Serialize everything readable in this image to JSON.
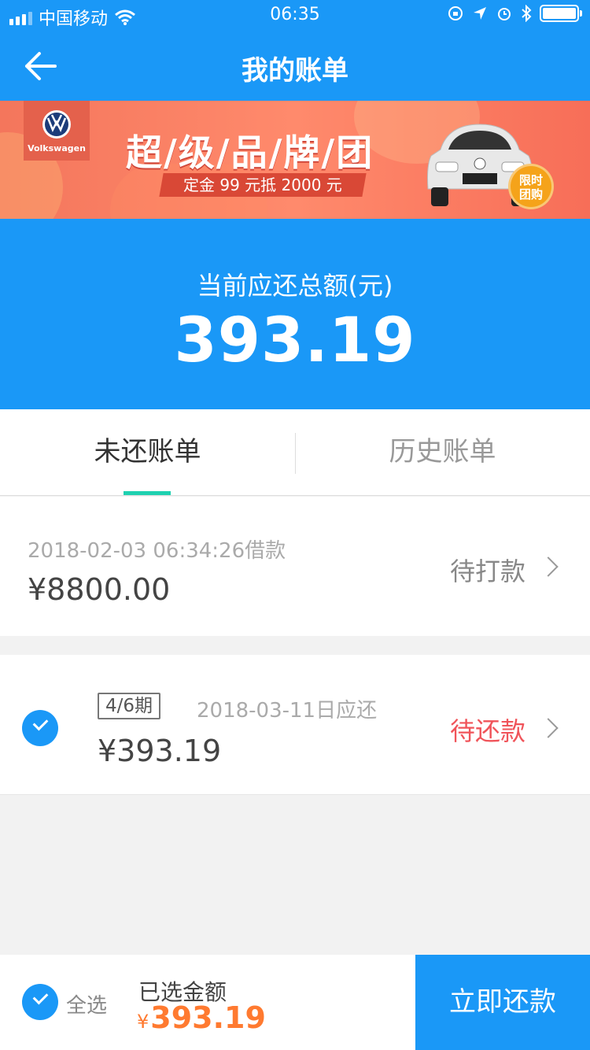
{
  "status_bar": {
    "carrier": "中国移动",
    "time": "06:35"
  },
  "header": {
    "title": "我的账单"
  },
  "banner": {
    "brand": "Volkswagen",
    "headline": "超/级/品/牌/团",
    "subline": "定金 99 元抵 2000 元",
    "badge_line1": "限时",
    "badge_line2": "团购"
  },
  "summary": {
    "label": "当前应还总额(元)",
    "amount": "393.19"
  },
  "tabs": [
    {
      "label": "未还账单",
      "active": true
    },
    {
      "label": "历史账单",
      "active": false
    }
  ],
  "bills": [
    {
      "date": "2018-02-03 06:34:26借款",
      "amount": "¥8800.00",
      "status": "待打款",
      "status_color": "#888888"
    },
    {
      "period": "4/6期",
      "date": "2018-03-11日应还",
      "amount": "¥393.19",
      "status": "待还款",
      "status_color": "#f0545a",
      "checked": true
    }
  ],
  "footer": {
    "select_all_label": "全选",
    "selected_label": "已选金额",
    "currency": "¥",
    "selected_amount": "393.19",
    "pay_button": "立即还款"
  },
  "colors": {
    "primary": "#1a98f7",
    "accent_teal": "#1fd1b0",
    "amount_orange": "#ff7a30",
    "pending_red": "#f0545a"
  }
}
